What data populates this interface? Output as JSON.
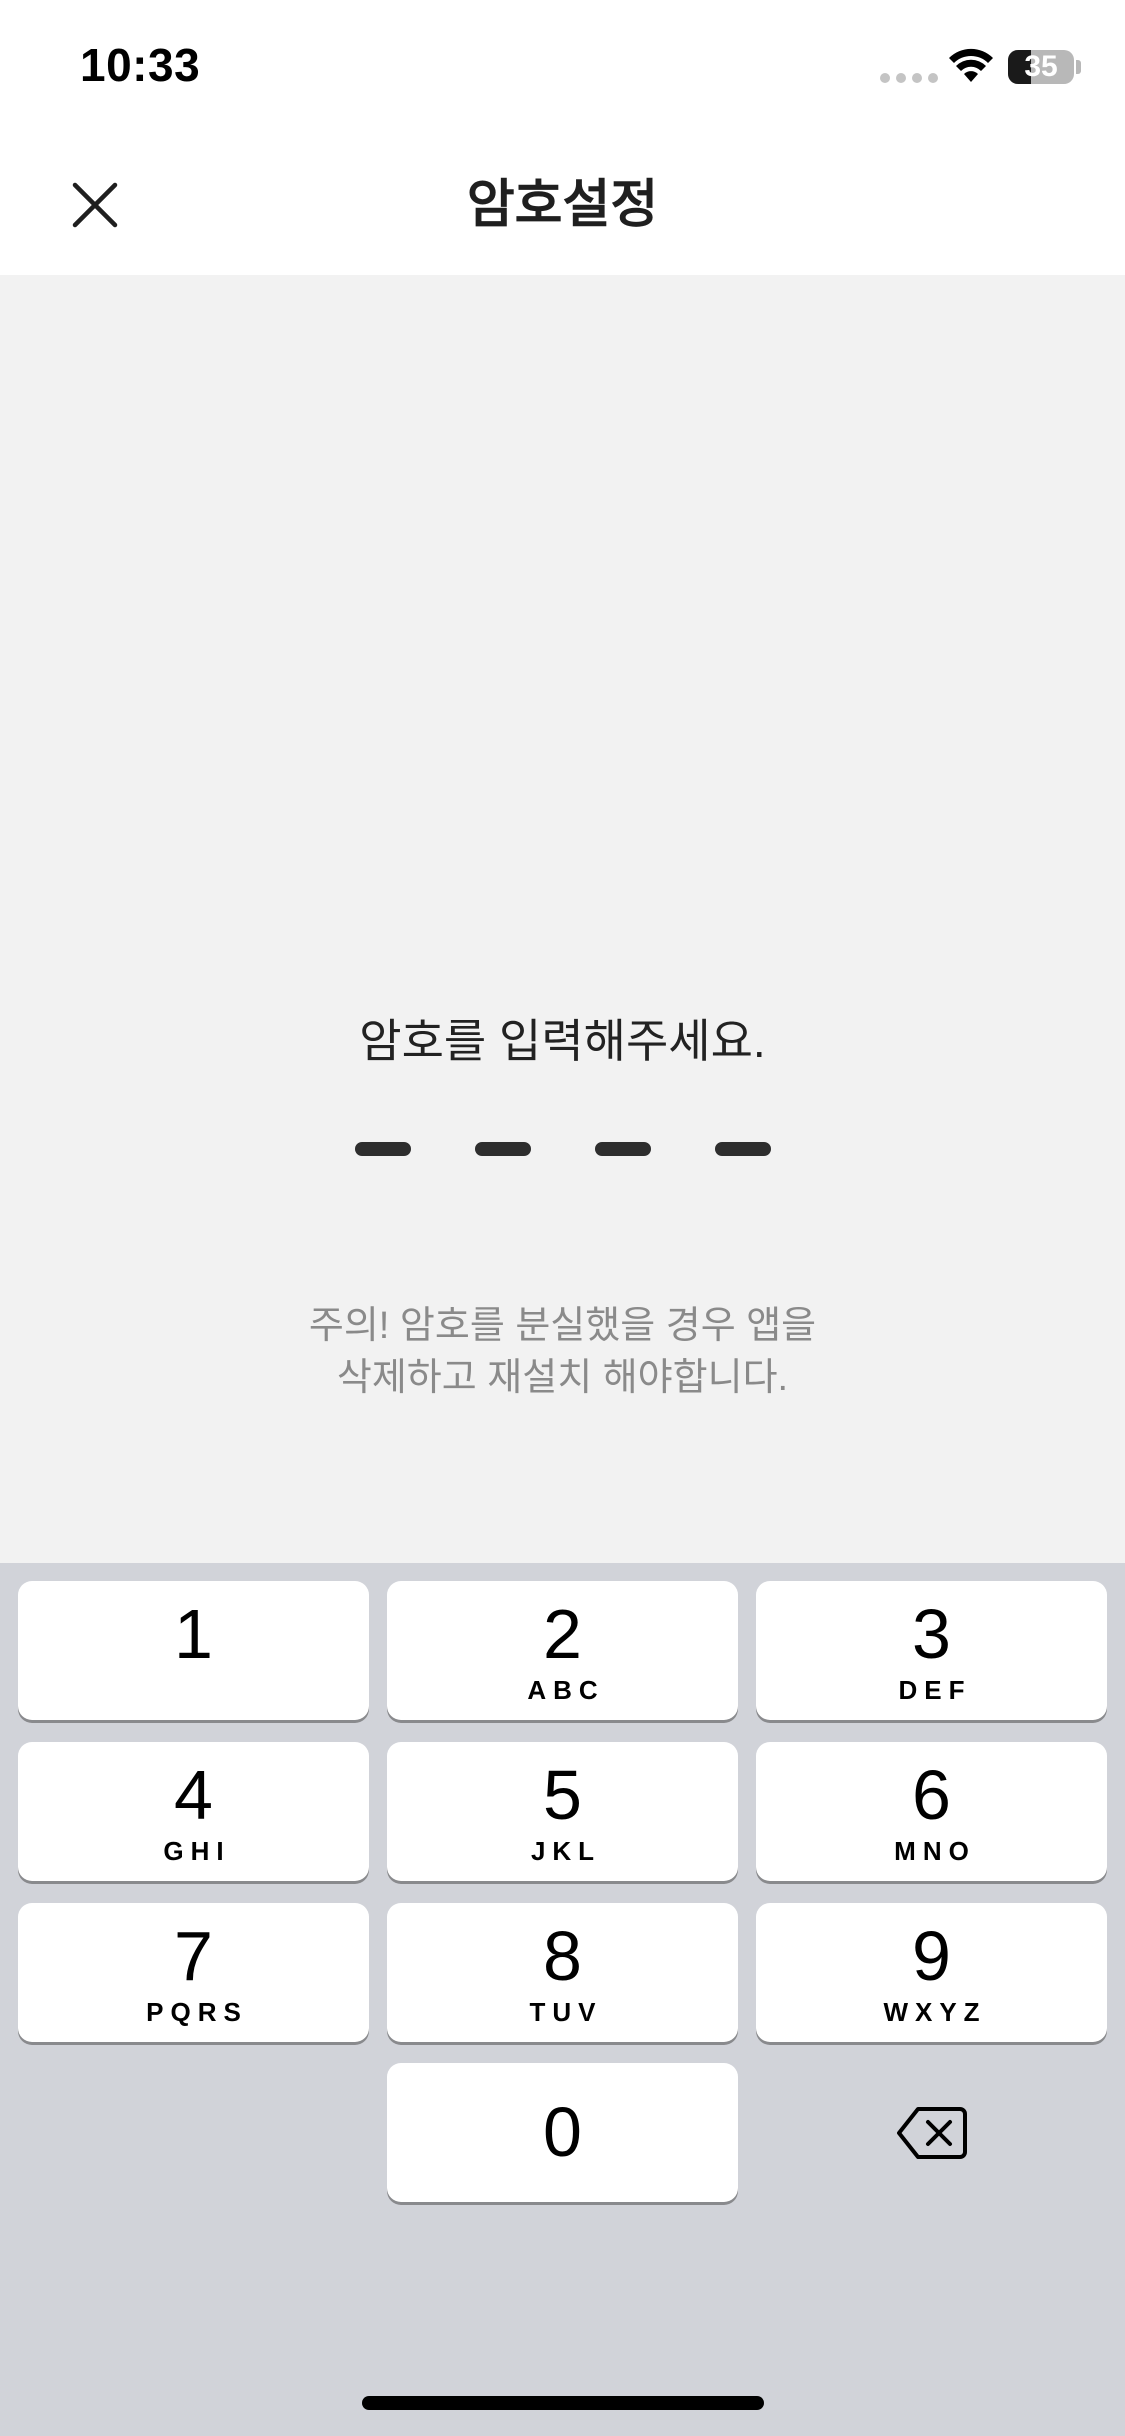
{
  "status_bar": {
    "time": "10:33",
    "battery_level": "35",
    "battery_fraction": 0.35
  },
  "header": {
    "title": "암호설정",
    "close_icon": "close-icon"
  },
  "passcode": {
    "prompt": "암호를 입력해주세요.",
    "entered_digits": 0,
    "total_digits": 4,
    "warning_line1": "주의! 암호를 분실했을 경우 앱을",
    "warning_line2": "삭제하고 재설치 해야합니다."
  },
  "keypad": {
    "keys": [
      {
        "digit": "1",
        "letters": ""
      },
      {
        "digit": "2",
        "letters": "ABC"
      },
      {
        "digit": "3",
        "letters": "DEF"
      },
      {
        "digit": "4",
        "letters": "GHI"
      },
      {
        "digit": "5",
        "letters": "JKL"
      },
      {
        "digit": "6",
        "letters": "MNO"
      },
      {
        "digit": "7",
        "letters": "PQRS"
      },
      {
        "digit": "8",
        "letters": "TUV"
      },
      {
        "digit": "9",
        "letters": "WXYZ"
      }
    ],
    "zero": {
      "digit": "0"
    },
    "backspace_icon": "backspace-icon"
  },
  "colors": {
    "content_background": "#f2f2f2",
    "keypad_background": "#d1d3d9",
    "key_background": "#ffffff",
    "warning_text": "#8a8a8a"
  }
}
